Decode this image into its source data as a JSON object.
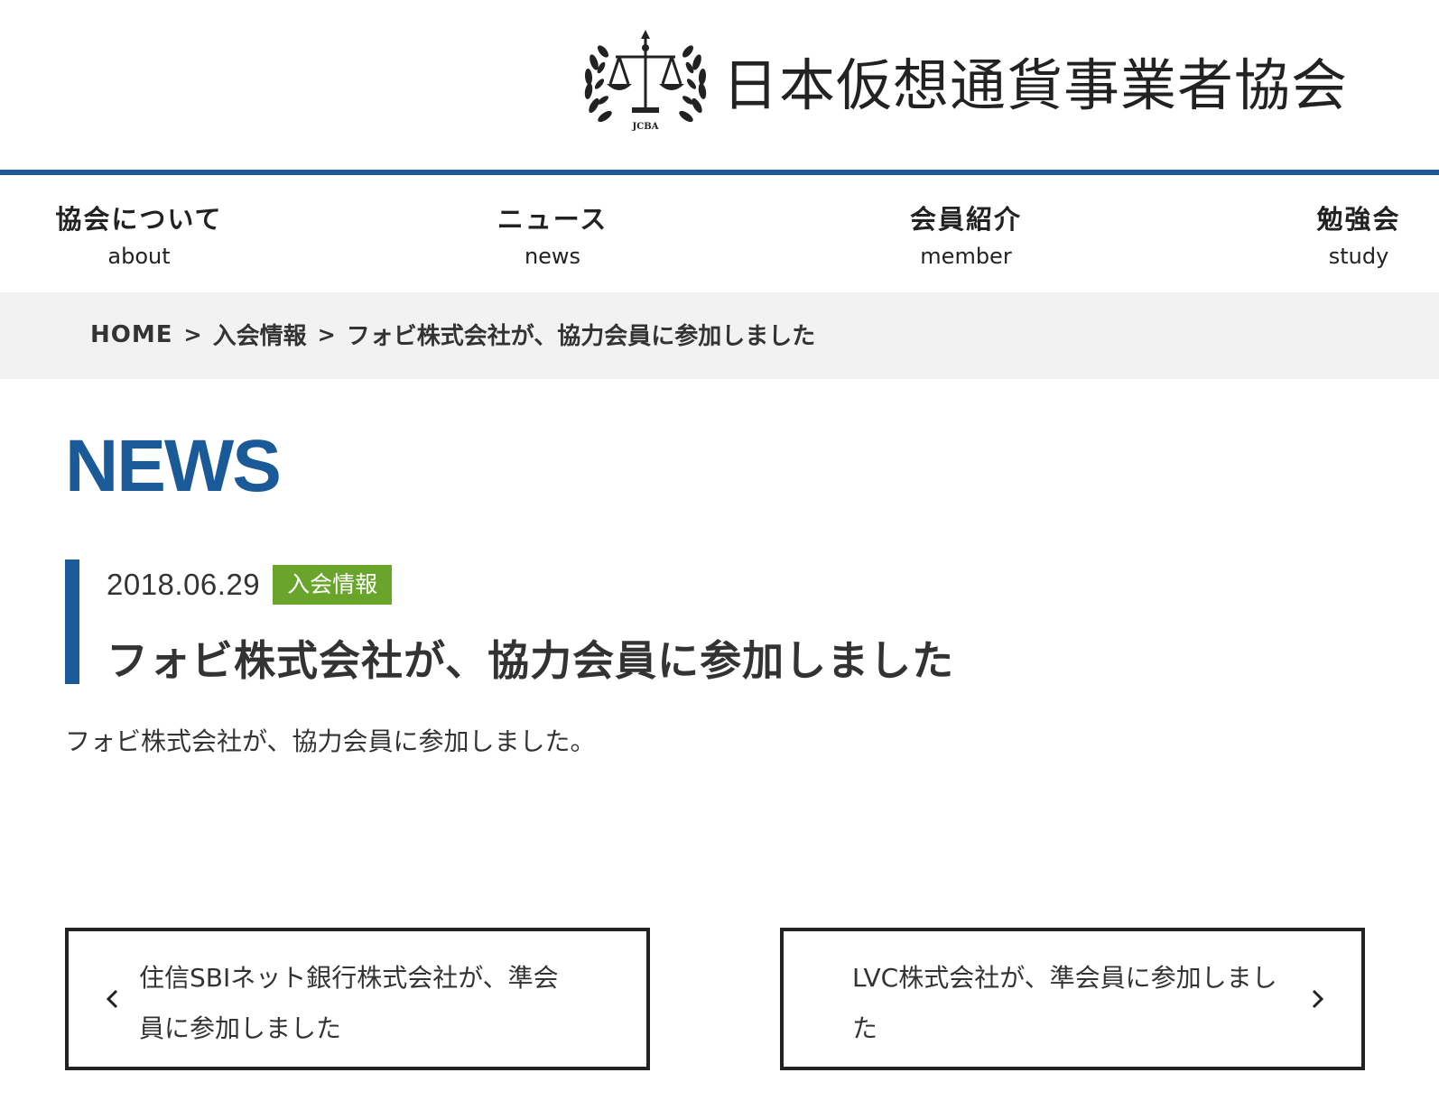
{
  "site": {
    "logo_text": "日本仮想通貨事業者協会",
    "emblem_caption": "JCBA",
    "accent_color": "#1a5a99",
    "badge_color": "#6aa52b"
  },
  "nav": {
    "items": [
      {
        "jp": "協会について",
        "en": "about"
      },
      {
        "jp": "ニュース",
        "en": "news"
      },
      {
        "jp": "会員紹介",
        "en": "member"
      },
      {
        "jp": "勉強会",
        "en": "study"
      }
    ]
  },
  "breadcrumb": {
    "home": "HOME",
    "category": "入会情報",
    "current": "フォビ株式会社が、協力会員に参加しました",
    "separator": ">"
  },
  "page": {
    "heading": "NEWS"
  },
  "article": {
    "date": "2018.06.29",
    "category": "入会情報",
    "title": "フォビ株式会社が、協力会員に参加しました",
    "body": "フォビ株式会社が、協力会員に参加しました。"
  },
  "pager": {
    "prev_title": "住信SBIネット銀行株式会社が、準会員に参加しました",
    "next_title": "LVC株式会社が、準会員に参加しました",
    "prev_icon": "chevron-left-icon",
    "next_icon": "chevron-right-icon"
  }
}
